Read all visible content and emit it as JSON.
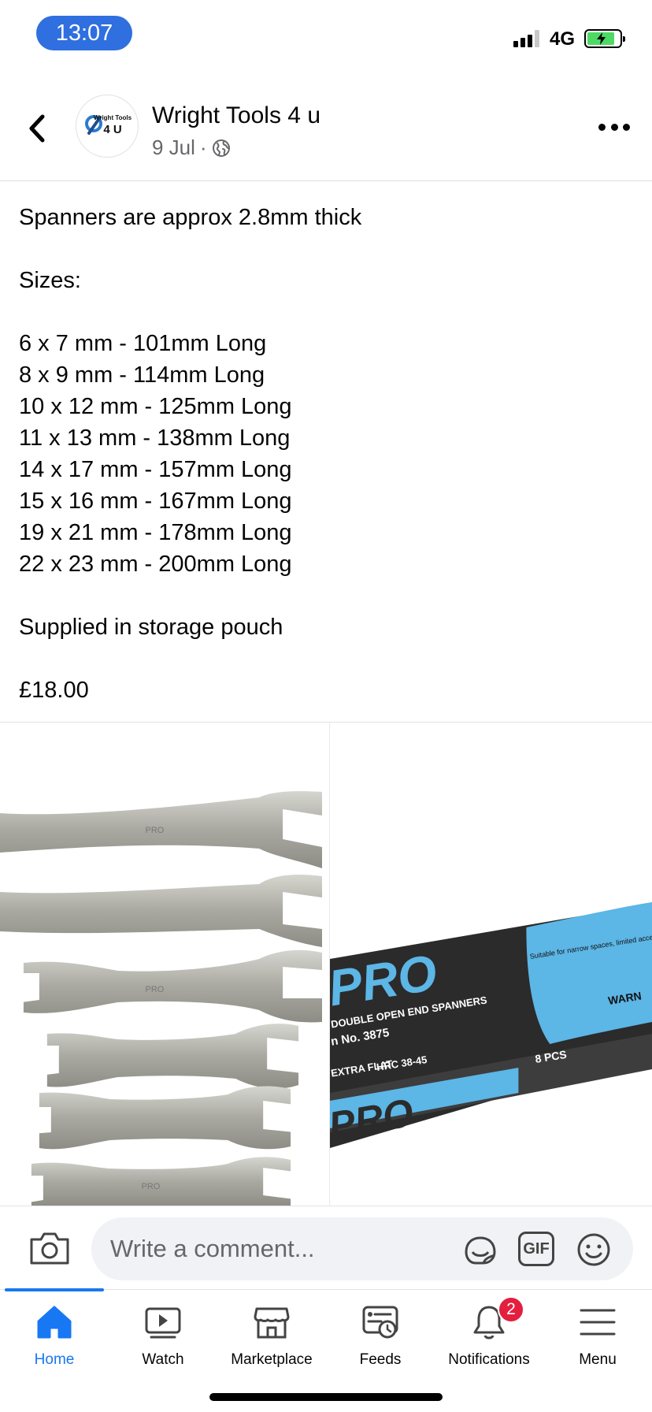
{
  "status_bar": {
    "time": "13:07",
    "network": "4G",
    "signal_bars": 3,
    "signal_bars_total": 4,
    "battery_charging": true,
    "battery_color": "#4cd964",
    "time_pill_color": "#2f6fdf"
  },
  "post_header": {
    "back_icon": "chevron-left-icon",
    "page_name": "Wright Tools 4 u",
    "date": "9 Jul",
    "separator": "·",
    "audience_icon": "globe-icon",
    "more_icon": "ellipsis-icon",
    "avatar": {
      "logo_line1": "Wright Tools",
      "logo_line2": "4 U"
    }
  },
  "post_body": {
    "intro": "Spanners are approx 2.8mm thick",
    "sizes_heading": "Sizes:",
    "sizes": [
      "6 x 7 mm - 101mm Long",
      "8 x 9 mm - 114mm Long",
      "10 x 12 mm - 125mm Long",
      "11 x 13 mm - 138mm Long",
      "14 x 17 mm - 157mm Long",
      "15 x 16 mm - 167mm Long",
      "19 x 21 mm - 178mm Long",
      "22 x 23 mm - 200mm Long"
    ],
    "note": "Supplied in storage pouch",
    "price": "£18.00"
  },
  "photos": {
    "left": {
      "spanner_marks": [
        "PRO",
        "PRO",
        "PRO",
        "PRO",
        "PRO",
        "PRO"
      ]
    },
    "right": {
      "brand": "PRO",
      "line1": "DOUBLE OPEN END SPANNERS",
      "line2": "n No. 3875",
      "badge1": "EXTRA FLAT",
      "badge2": "HRC 38-45",
      "side_note": "Suitable for narrow spaces, limited access.",
      "warn": "WARN",
      "count": "8 PCS",
      "footer": "DOUBLE OPEN END SPANNERS"
    }
  },
  "comment_bar": {
    "camera_icon": "camera-icon",
    "placeholder": "Write a comment...",
    "sticker_icon": "sticker-icon",
    "gif_label": "GIF",
    "emoji_icon": "emoji-icon"
  },
  "tab_bar": {
    "accent": "#1877f2",
    "tabs": [
      {
        "label": "Home",
        "icon": "home-icon",
        "active": true
      },
      {
        "label": "Watch",
        "icon": "watch-icon",
        "active": false
      },
      {
        "label": "Marketplace",
        "icon": "marketplace-icon",
        "active": false
      },
      {
        "label": "Feeds",
        "icon": "feeds-icon",
        "active": false
      },
      {
        "label": "Notifications",
        "icon": "bell-icon",
        "active": false,
        "badge": "2"
      },
      {
        "label": "Menu",
        "icon": "menu-icon",
        "active": false
      }
    ]
  }
}
